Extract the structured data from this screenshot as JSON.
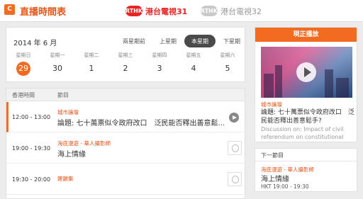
{
  "header": {
    "logo_text": "C",
    "title": "直播時間表",
    "channels": [
      {
        "badge": "RTHK31",
        "name": "港台電視31",
        "active": true,
        "color": "#e52521"
      },
      {
        "badge": "RTHK32",
        "name": "港台電視32",
        "active": false,
        "color": "#c9c9c9"
      }
    ]
  },
  "calendar": {
    "month_label": "2014 年 6 月",
    "nav": {
      "prev2": "兩星期前",
      "prev": "上星期",
      "this": "本星期",
      "next": "下星期"
    },
    "days": [
      {
        "weekday": "星期日",
        "date": "29",
        "selected": true
      },
      {
        "weekday": "星期一",
        "date": "30",
        "selected": false
      },
      {
        "weekday": "星期二",
        "date": "1",
        "selected": false
      },
      {
        "weekday": "星期三",
        "date": "2",
        "selected": false
      },
      {
        "weekday": "星期四",
        "date": "3",
        "selected": false
      },
      {
        "weekday": "星期五",
        "date": "4",
        "selected": false
      },
      {
        "weekday": "星期六",
        "date": "5",
        "selected": false
      }
    ]
  },
  "schedule": {
    "headers": {
      "time": "香港時間",
      "program": "節目"
    },
    "rows": [
      {
        "time": "12:00 - 13:00",
        "series": "城市論壇",
        "title": "論題: 七十萬票似令政府改口　泛民能否釋出善意鬆...",
        "current": true
      },
      {
        "time": "19:00 - 19:30",
        "series": "海底漫遊 - 華人攝影師",
        "title": "海上情緣",
        "current": false
      },
      {
        "time": "19:30 - 20:00",
        "series": "鏗鏘集",
        "title": "",
        "current": false
      }
    ]
  },
  "now_playing": {
    "header": "現正播放",
    "series": "城市論壇",
    "title": "論題: 七十萬票似令政府改口　泛民能否釋出善意鬆手?",
    "description": "Discussion on: Impact of civil referendum on constitutional"
  },
  "next_program": {
    "header": "下一節目",
    "series": "海底漫遊 - 華人攝影師",
    "title": "海上情緣",
    "time": "HKT 19:00 - 19:30"
  },
  "colors": {
    "accent": "#f26b21",
    "channel_red": "#e52521"
  }
}
